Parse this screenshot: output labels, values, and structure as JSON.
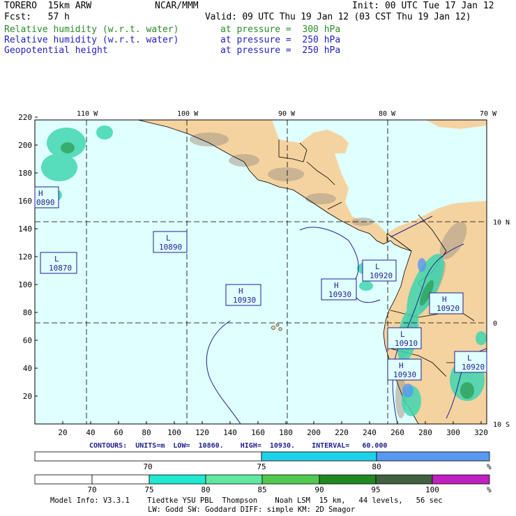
{
  "header": {
    "model": "TORERO  15km ARW",
    "center": "NCAR/MMM",
    "init": "Init: 00 UTC Tue 17 Jan 12",
    "fcst": "Fcst:   57 h",
    "valid": "Valid: 09 UTC Thu 19 Jan 12 (03 CST Thu 19 Jan 12)",
    "fields": [
      {
        "name": "Relative humidity (w.r.t. water)",
        "level": "at pressure =  300 hPa",
        "color": "#2a8a2a"
      },
      {
        "name": "Relative humidity (w.r.t. water)",
        "level": "at pressure =  250 hPa",
        "color": "#1f1fbf"
      },
      {
        "name": "Geopotential height",
        "level": "at pressure =  250 hPa",
        "color": "#1f1fbf"
      }
    ]
  },
  "map": {
    "top_lon_labels": [
      "110 W",
      "100 W",
      "90 W",
      "80 W",
      "70 W"
    ],
    "right_lat_labels": [
      "10 N",
      "0",
      "10 S"
    ],
    "left_ticks": [
      220,
      200,
      180,
      160,
      140,
      120,
      100,
      80,
      60,
      40,
      20
    ],
    "bottom_ticks": [
      20,
      40,
      60,
      80,
      100,
      120,
      140,
      160,
      180,
      200,
      220,
      240,
      260,
      280,
      300,
      320
    ],
    "colors": {
      "ocean": "#e0ffff",
      "land": "#f5d3a0",
      "contour": "#1f1f8f",
      "border": "#000000"
    },
    "centers": [
      {
        "type": "H",
        "value": "0890"
      },
      {
        "type": "L",
        "value": "10870"
      },
      {
        "type": "L",
        "value": "10890"
      },
      {
        "type": "H",
        "value": "10930"
      },
      {
        "type": "H",
        "value": "10930"
      },
      {
        "type": "L",
        "value": "10920"
      },
      {
        "type": "H",
        "value": "10920"
      },
      {
        "type": "L",
        "value": "10910"
      },
      {
        "type": "L",
        "value": "10920"
      },
      {
        "type": "H",
        "value": "10930"
      }
    ]
  },
  "contours_info": "CONTOURS:  UNITS=m  LOW=  10860.    HIGH=  10930.    INTERVAL=   60.000",
  "colorbar1": {
    "labels": [
      "70",
      "75",
      "80"
    ],
    "unit": "%",
    "colors": [
      "#ffffff",
      "#20d0e8",
      "#5898f0"
    ]
  },
  "colorbar2": {
    "labels": [
      "70",
      "75",
      "80",
      "85",
      "90",
      "95",
      "100"
    ],
    "unit": "%",
    "colors": [
      "#ffffff",
      "#ffffff",
      "#20e8d0",
      "#60e8a0",
      "#50c850",
      "#208820",
      "#406040",
      "#c020c0"
    ]
  },
  "footer": {
    "line1": "Model Info: V3.3.1    Tiedtke YSU PBL  Thompson    Noah LSM  15 km,   44 levels,   56 sec",
    "line2": "LW: Godd SW: Goddard DIFF: simple KM: 2D Smagor"
  }
}
